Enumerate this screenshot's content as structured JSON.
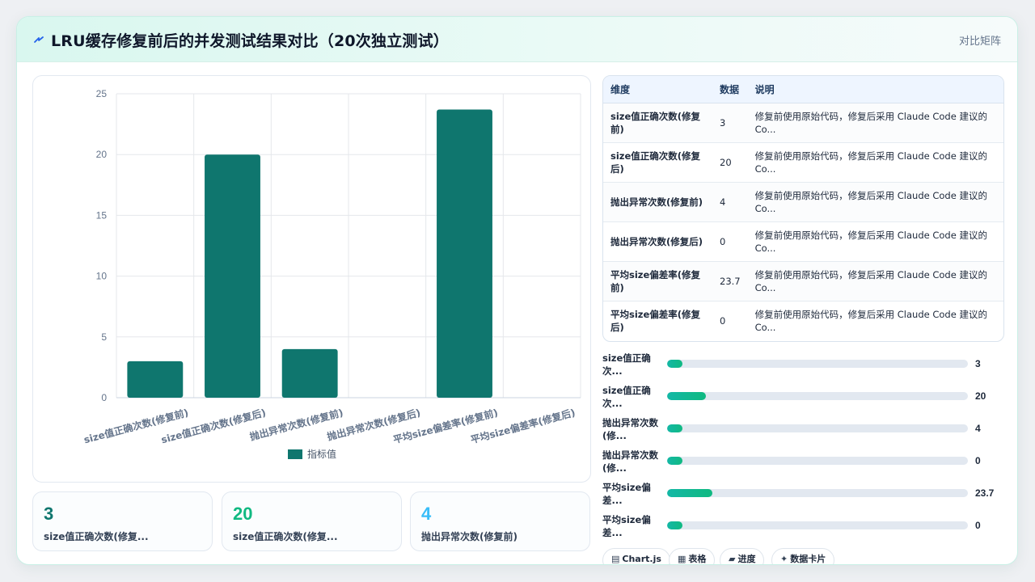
{
  "header": {
    "title": "LRU缓存修复前后的并发测试结果对比（20次独立测试）",
    "right_label": "对比矩阵",
    "icon": "lightning-bolt-icon"
  },
  "chart_data": {
    "type": "bar",
    "categories": [
      "size值正确次数(修复前)",
      "size值正确次数(修复后)",
      "抛出异常次数(修复前)",
      "抛出异常次数(修复后)",
      "平均size偏差率(修复前)",
      "平均size偏差率(修复后)"
    ],
    "series": [
      {
        "name": "指标值",
        "values": [
          3,
          20,
          4,
          0,
          23.7,
          0
        ],
        "color": "#0f766e"
      }
    ],
    "ylim": [
      0,
      25
    ],
    "yticks": [
      0,
      5,
      10,
      15,
      20,
      25
    ],
    "grid": true,
    "legend": "bottom"
  },
  "stats": [
    {
      "value": "3",
      "label": "size值正确次数(修复...",
      "color": "#0f766e"
    },
    {
      "value": "20",
      "label": "size值正确次数(修复...",
      "color": "#10b981"
    },
    {
      "value": "4",
      "label": "抛出异常次数(修复前)",
      "color": "#38bdf8"
    }
  ],
  "table": {
    "headers": [
      "维度",
      "数据",
      "说明"
    ],
    "rows": [
      {
        "dim": "size值正确次数(修复前)",
        "num": "3",
        "desc": "修复前使用原始代码，修复后采用 Claude Code 建议的 Co..."
      },
      {
        "dim": "size值正确次数(修复后)",
        "num": "20",
        "desc": "修复前使用原始代码，修复后采用 Claude Code 建议的 Co..."
      },
      {
        "dim": "抛出异常次数(修复前)",
        "num": "4",
        "desc": "修复前使用原始代码，修复后采用 Claude Code 建议的 Co..."
      },
      {
        "dim": "抛出异常次数(修复后)",
        "num": "0",
        "desc": "修复前使用原始代码，修复后采用 Claude Code 建议的 Co..."
      },
      {
        "dim": "平均size偏差率(修复前)",
        "num": "23.7",
        "desc": "修复前使用原始代码，修复后采用 Claude Code 建议的 Co..."
      },
      {
        "dim": "平均size偏差率(修复后)",
        "num": "0",
        "desc": "修复前使用原始代码，修复后采用 Claude Code 建议的 Co..."
      }
    ]
  },
  "progress": [
    {
      "label": "size值正确次...",
      "value": "3",
      "fraction": 0.05
    },
    {
      "label": "size值正确次...",
      "value": "20",
      "fraction": 0.13
    },
    {
      "label": "抛出异常次数(修...",
      "value": "4",
      "fraction": 0.05
    },
    {
      "label": "抛出异常次数(修...",
      "value": "0",
      "fraction": 0.05
    },
    {
      "label": "平均size偏差...",
      "value": "23.7",
      "fraction": 0.15
    },
    {
      "label": "平均size偏差...",
      "value": "0",
      "fraction": 0.05
    }
  ],
  "tags": [
    {
      "icon": "chart-icon",
      "glyph": "▤",
      "label": "Chart.js"
    },
    {
      "icon": "table-icon",
      "glyph": "▦",
      "label": "表格"
    },
    {
      "icon": "progress-icon",
      "glyph": "▰",
      "label": "进度"
    },
    {
      "icon": "sparkle-icon",
      "glyph": "✦",
      "label": "数据卡片"
    }
  ]
}
